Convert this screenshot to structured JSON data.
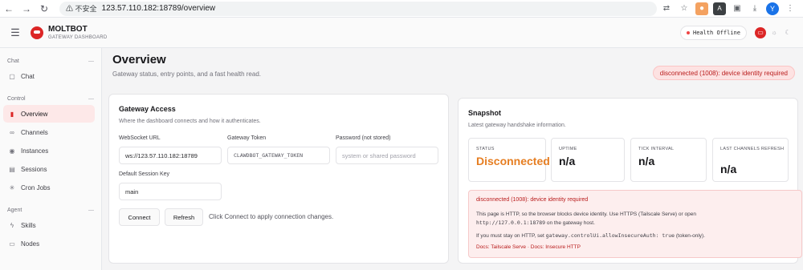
{
  "browser": {
    "security_label": "不安全",
    "url": "123.57.110.182:18789/overview",
    "profile_initial": "Y"
  },
  "app": {
    "brand_name": "MOLTBOT",
    "brand_sub": "GATEWAY DASHBOARD",
    "health_label": "Health Offline"
  },
  "sidebar": {
    "sections": [
      {
        "title": "Chat",
        "items": [
          {
            "label": "Chat",
            "icon": "chat-icon"
          }
        ]
      },
      {
        "title": "Control",
        "items": [
          {
            "label": "Overview",
            "icon": "bar-chart-icon",
            "active": true
          },
          {
            "label": "Channels",
            "icon": "link-icon"
          },
          {
            "label": "Instances",
            "icon": "radio-icon"
          },
          {
            "label": "Sessions",
            "icon": "file-icon"
          },
          {
            "label": "Cron Jobs",
            "icon": "loader-icon"
          }
        ]
      },
      {
        "title": "Agent",
        "items": [
          {
            "label": "Skills",
            "icon": "zap-icon"
          },
          {
            "label": "Nodes",
            "icon": "monitor-icon"
          }
        ]
      }
    ]
  },
  "page": {
    "title": "Overview",
    "subtitle": "Gateway status, entry points, and a fast health read.",
    "error_pill": "disconnected (1008): device identity required"
  },
  "access": {
    "title": "Gateway Access",
    "subtitle": "Where the dashboard connects and how it authenticates.",
    "ws_label": "WebSocket URL",
    "ws_value": "ws://123.57.110.182:18789",
    "token_label": "Gateway Token",
    "token_value": "CLAWDBOT_GATEWAY_TOKEN",
    "password_label": "Password (not stored)",
    "password_placeholder": "system or shared password",
    "session_label": "Default Session Key",
    "session_value": "main",
    "connect": "Connect",
    "refresh": "Refresh",
    "hint": "Click Connect to apply connection changes."
  },
  "snapshot": {
    "title": "Snapshot",
    "subtitle": "Latest gateway handshake information.",
    "status_label": "STATUS",
    "status_value": "Disconnected",
    "uptime_label": "UPTIME",
    "uptime_value": "n/a",
    "tick_label": "TICK INTERVAL",
    "tick_value": "n/a",
    "channels_label": "LAST CHANNELS REFRESH",
    "channels_value": "n/a",
    "alert_title": "disconnected (1008): device identity required",
    "alert_body_1": "This page is HTTP, so the browser blocks device identity. Use HTTPS (Tailscale Serve) or open",
    "alert_body_url": "http://127.0.0.1:18789",
    "alert_body_2": " on the gateway host.",
    "alert_body_3a": "If you must stay on HTTP, set ",
    "alert_body_code": "gateway.controlUi.allowInsecureAuth: true",
    "alert_body_3b": " (token-only).",
    "alert_links": "Docs: Tailscale Serve · Docs: Insecure HTTP"
  }
}
